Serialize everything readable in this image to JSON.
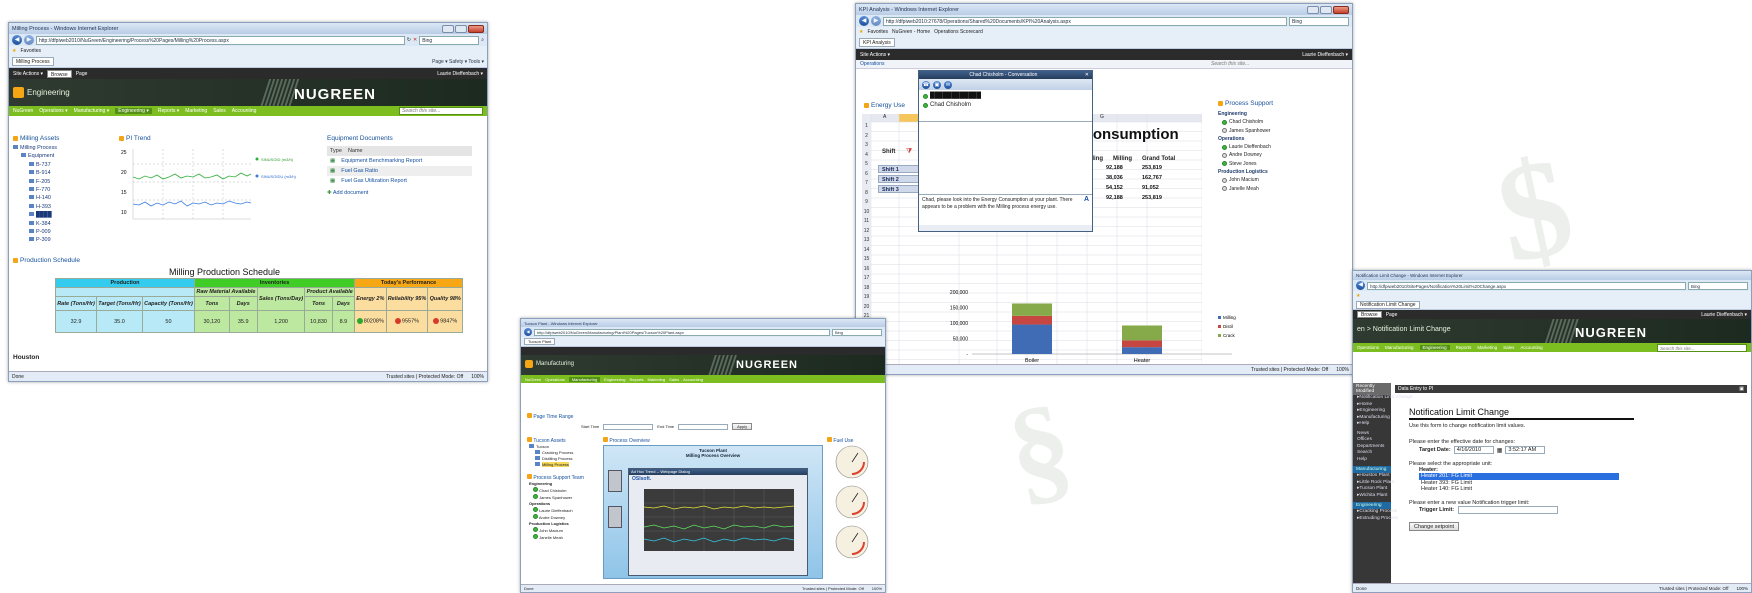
{
  "windows": {
    "milling": {
      "title": "Milling Process - Windows Internet Explorer",
      "url": "http://dfpiweb2010/NuGreen/Engineering/Process%20Pages/Milling%20Process.aspx",
      "search": "Bing",
      "favorites": "Favorites",
      "tab": "Milling Process",
      "toolbar": "Page ▾   Safety ▾   Tools ▾",
      "ribbon": {
        "site_actions": "Site Actions ▾",
        "browse": "Browse",
        "page": "Page",
        "user": "Laurie Dieffenbach ▾"
      },
      "site": "Engineering",
      "logo": "NUGREEN",
      "nav": [
        "NuGreen",
        "Operations ▾",
        "Manufacturing ▾",
        "Engineering ▾",
        "Reports ▾",
        "Marketing",
        "Sales",
        "Accounting"
      ],
      "search_placeholder": "Search this site...",
      "assets_title": "Milling Assets",
      "assets": [
        "Milling Process",
        "Equipment",
        "B-737",
        "B-914",
        "F-205",
        "F-770",
        "H-140",
        "H-393",
        "████",
        "K-384",
        "P-009",
        "P-309"
      ],
      "trend_title": "PI Trend",
      "trend_yticks": [
        "25",
        "20",
        "15",
        "10"
      ],
      "trend_legend": [
        "SINUSOID (m3/h)",
        "SINUSOIDU (m3/h)"
      ],
      "docs_title": "Equipment Documents",
      "docs_head": [
        "Type",
        "Name"
      ],
      "docs": [
        "Equipment Benchmarking Report",
        "Fuel Gas Ratio",
        "Fuel Gas Utilization Report"
      ],
      "add_doc": "Add document",
      "schedule_link": "Production Schedule",
      "schedule": {
        "title": "Milling Production Schedule",
        "groups": [
          "Production",
          "Inventories",
          "Today's Performance"
        ],
        "subgroups": [
          "Raw Material Available",
          "Product Available"
        ],
        "cols": [
          "Rate (Tons/Hr)",
          "Target (Tons/Hr)",
          "Capacity (Tons/Hr)",
          "Tons",
          "Days",
          "Sales (Tons/Day)",
          "Tons",
          "Days",
          "Energy 2%",
          "Reliability 95%",
          "Quality 98%"
        ],
        "row_label": "Houston",
        "row": [
          "32.9",
          "35.0",
          "50",
          "30,120",
          "35.9",
          "1,200",
          "10,830",
          "8.9",
          "80208%",
          "9557%",
          "9847%"
        ]
      },
      "status": {
        "left": "Done",
        "zone": "Trusted sites | Protected Mode: Off",
        "zoom": "100%"
      }
    },
    "kpi": {
      "title": "KPI Analysis - Windows Internet Explorer",
      "url": "http://dfpiweb2010:27678/Operations/Shared%20Documents/KPI%20Analysis.aspx",
      "search": "Bing",
      "favorites": "Favorites",
      "fav_links": [
        "NuGreen - Home",
        "Operations Scorecard"
      ],
      "tab": "KPI Analysis",
      "ribbon": {
        "site_actions": "Site Actions ▾",
        "user": "Laurie Dieffenbach ▾"
      },
      "nav_left": "Operations",
      "search_placeholder": "Search this site...",
      "panel_title": "Energy Use",
      "sheet_title": "Consumption",
      "col_letters": [
        "A",
        "B",
        "C",
        "D",
        "E",
        "F",
        "G"
      ],
      "table_head": [
        "Shift",
        "Milling",
        "Milling",
        "Grand Total"
      ],
      "rows": [
        {
          "label": "Shift 1",
          "a": "6,175",
          "b": "92,188",
          "c": "253,819"
        },
        {
          "label": "Shift 2",
          "a": "7,321",
          "b": "38,036",
          "c": "162,767"
        },
        {
          "label": "Shift 3",
          "a": "6,854",
          "b": "54,152",
          "c": "91,052"
        },
        {
          "label": "",
          "a": "6,175",
          "b": "92,188",
          "c": "253,819"
        }
      ],
      "chart_data": {
        "type": "bar",
        "categories": [
          "Boiler",
          "Heater"
        ],
        "yticks": [
          "200,000",
          "150,000",
          "100,000",
          "50,000",
          "-"
        ],
        "ylim": [
          0,
          200000
        ],
        "series": [
          {
            "name": "Milling",
            "color": "#3f6cb5",
            "values": [
              95000,
              22000
            ]
          },
          {
            "name": "Distil",
            "color": "#c64642",
            "values": [
              28000,
              22000
            ]
          },
          {
            "name": "Crack",
            "color": "#86a94a",
            "values": [
              40000,
              48000
            ]
          }
        ]
      },
      "presence": {
        "title": "Process  Support",
        "groups": [
          {
            "name": "Engineering",
            "people": [
              {
                "n": "Chad Chisholm",
                "on": true
              },
              {
                "n": "James Spanhower",
                "on": false
              }
            ]
          },
          {
            "name": "Operations",
            "people": [
              {
                "n": "Laurie Dieffenbach",
                "on": true
              },
              {
                "n": "Andre Downey",
                "on": false
              },
              {
                "n": "Steve Jones",
                "on": true
              }
            ]
          },
          {
            "name": "Production Logistics",
            "people": [
              {
                "n": "John Macium",
                "on": false
              },
              {
                "n": "Janelle Meah",
                "on": false
              }
            ]
          }
        ]
      },
      "im": {
        "title": "Chad Chisholm - Conversation",
        "contacts": [
          "████████████",
          "Chad Chisholm"
        ],
        "message": "Chad, please look into the Energy Consumption at your plant. There appears to be a problem with the Milling process energy use."
      },
      "status": {
        "zone": "Trusted sites | Protected Mode: Off",
        "zoom": "100%"
      }
    },
    "tucson": {
      "title": "Tucson Plant - Windows Internet Explorer",
      "url": "http://dfpiweb2010/NuGreen/Manufacturing/Plant%20Pages/Tucson%20Plant.aspx",
      "search": "Bing",
      "tab": "Tucson Plant",
      "site": "Manufacturing",
      "logo": "NUGREEN",
      "nav": [
        "NuGreen",
        "Operations",
        "Manufacturing",
        "Engineering",
        "Reports",
        "Marketing",
        "Sales",
        "Accounting"
      ],
      "time_range": "Page Time Range",
      "start_label": "Start Time",
      "end_label": "End Time",
      "apply": "Apply",
      "assets_title": "Tucson Assets",
      "assets": [
        "Tucson",
        "Cracking Process",
        "Distilling Process",
        "Milling Process"
      ],
      "people_title": "Process Support Team",
      "people": [
        "Engineering",
        "Chad Chisholm",
        "James Spanhower",
        "Operations",
        "Laurie Dieffenbach",
        "Andre Downey",
        "Production Logistics",
        "John Macium",
        "Janelle Meah"
      ],
      "overview_title": "Process Overview",
      "overview_head": "Tucson Plant",
      "overview_sub": "Milling Process Overview",
      "ad_hoc": "Ad Hoc Trend -- Webpage Dialog",
      "osi": "OSIsoft.",
      "fuel_title": "Fuel Use",
      "status": {
        "left": "Done",
        "zone": "Trusted sites | Protected Mode: Off",
        "zoom": "100%"
      }
    },
    "notify": {
      "title": "Notification Limit Change - Windows Internet Explorer",
      "url": "http://dfpiweb2010/SitePages/Notification%20Limit%20Change.aspx",
      "search": "Bing",
      "tab": "Notification Limit Change",
      "ribbon": {
        "browse": "Browse",
        "page": "Page",
        "user": "Laurie Dieffenbach ▾"
      },
      "site": "en > Notification Limit Change",
      "logo": "NUGREEN",
      "nav": [
        "Operations",
        "Manufacturing",
        "Engineering",
        "Reports",
        "Marketing",
        "Sales",
        "Accounting"
      ],
      "search_placeholder": "Search this site...",
      "side": {
        "recent": "Recently Modified",
        "recent_items": [
          "Notification Limit Change",
          "Home",
          "Engineering",
          "Manufacturing",
          "Help"
        ],
        "links": [
          "News",
          "Offices",
          "Departments",
          "Search",
          "Help"
        ],
        "manuf": "Manufacturing",
        "manuf_items": [
          "Houston Plant",
          "Little Rock Plant",
          "Tucson Plant",
          "Wichita Plant"
        ],
        "eng": "Engineering",
        "eng_items": [
          "Cracking Process",
          "Extruding Process"
        ]
      },
      "webpart": "Data Entry to PI",
      "form_title": "Notification Limit Change",
      "form_desc": "Use this form to change notification limit values.",
      "date_prompt": "Please enter the effective date for changes:",
      "target_label": "Target Date:",
      "target_date": "4/16/2010",
      "target_time": "3:52:17 AM",
      "unit_prompt": "Please select the appropriate unit:",
      "heater_label": "Heater:",
      "heaters": [
        "Heater 201: FG Limit",
        "Heater 393: FG Limit",
        "Heater 140: FG Limit"
      ],
      "limit_prompt": "Please enter a new value Notification trigger limit:",
      "trigger_label": "Trigger Limit:",
      "submit": "Change setpoint",
      "status": {
        "left": "Done",
        "zone": "Trusted sites | Protected Mode: Off",
        "zoom": "100%"
      }
    }
  }
}
